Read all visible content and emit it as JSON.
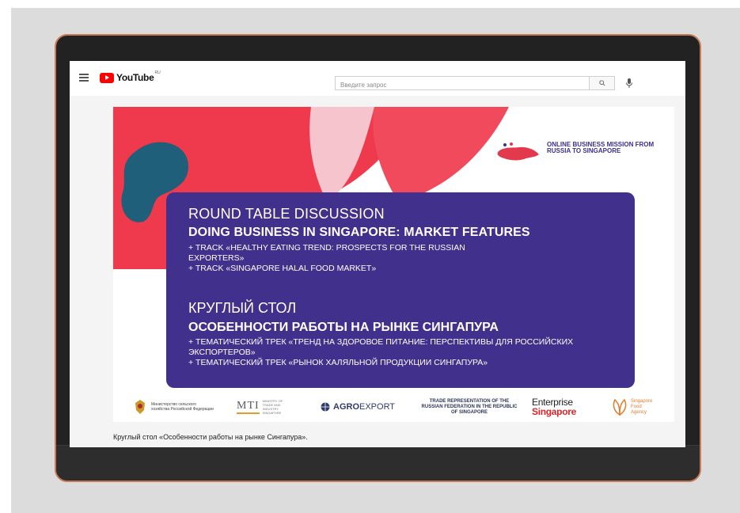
{
  "youtube": {
    "logo_text": "YouTube",
    "region": "RU",
    "search_placeholder": "Введите запрос"
  },
  "video": {
    "mission_title": "ONLINE BUSINESS MISSION FROM RUSSIA TO SINGAPORE",
    "card": {
      "en_heading": "ROUND TABLE DISCUSSION",
      "en_title": "DOING BUSINESS IN SINGAPORE: MARKET FEATURES",
      "en_track_1": "+ TRACK «HEALTHY EATING TREND: PROSPECTS FOR THE RUSSIAN EXPORTERS»",
      "en_track_2": "+ TRACK «SINGAPORE HALAL FOOD MARKET»",
      "ru_heading": "КРУГЛЫЙ СТОЛ",
      "ru_title": "ОСОБЕННОСТИ РАБОТЫ НА РЫНКЕ СИНГАПУРА",
      "ru_track_1": "+ ТЕМАТИЧЕСКИЙ ТРЕК «ТРЕНД НА ЗДОРОВОЕ ПИТАНИЕ: ПЕРСПЕКТИВЫ ДЛЯ РОССИЙСКИХ ЭКСПОРТЕРОВ»",
      "ru_track_2": "+ ТЕМАТИЧЕСКИЙ ТРЕК «РЫНОК ХАЛЯЛЬНОЙ ПРОДУКЦИИ СИНГАПУРА»"
    },
    "partners": {
      "ministry": "Министерство сельского хозяйства Российской Федерации",
      "mti_abbr": "MTI",
      "mti_full": "MINISTRY OF TRADE AND INDUSTRY SINGAPORE",
      "agro_bold": "AGRO",
      "agro_rest": "EXPORT",
      "trade_rep": "TRADE REPRESENTATION OF THE RUSSIAN FEDERATION IN THE REPUBLIC OF SINGAPORE",
      "enterprise_1": "Enterprise",
      "enterprise_2": "Singapore",
      "sfa": "Singapore Food Agency"
    }
  },
  "video_title": "Круглый стол «Особенности работы на рынке Сингапура».",
  "colors": {
    "card": "#41318c",
    "red": "#ee3a4c",
    "teal": "#1f5f79",
    "laptop_border": "#c77a53"
  }
}
